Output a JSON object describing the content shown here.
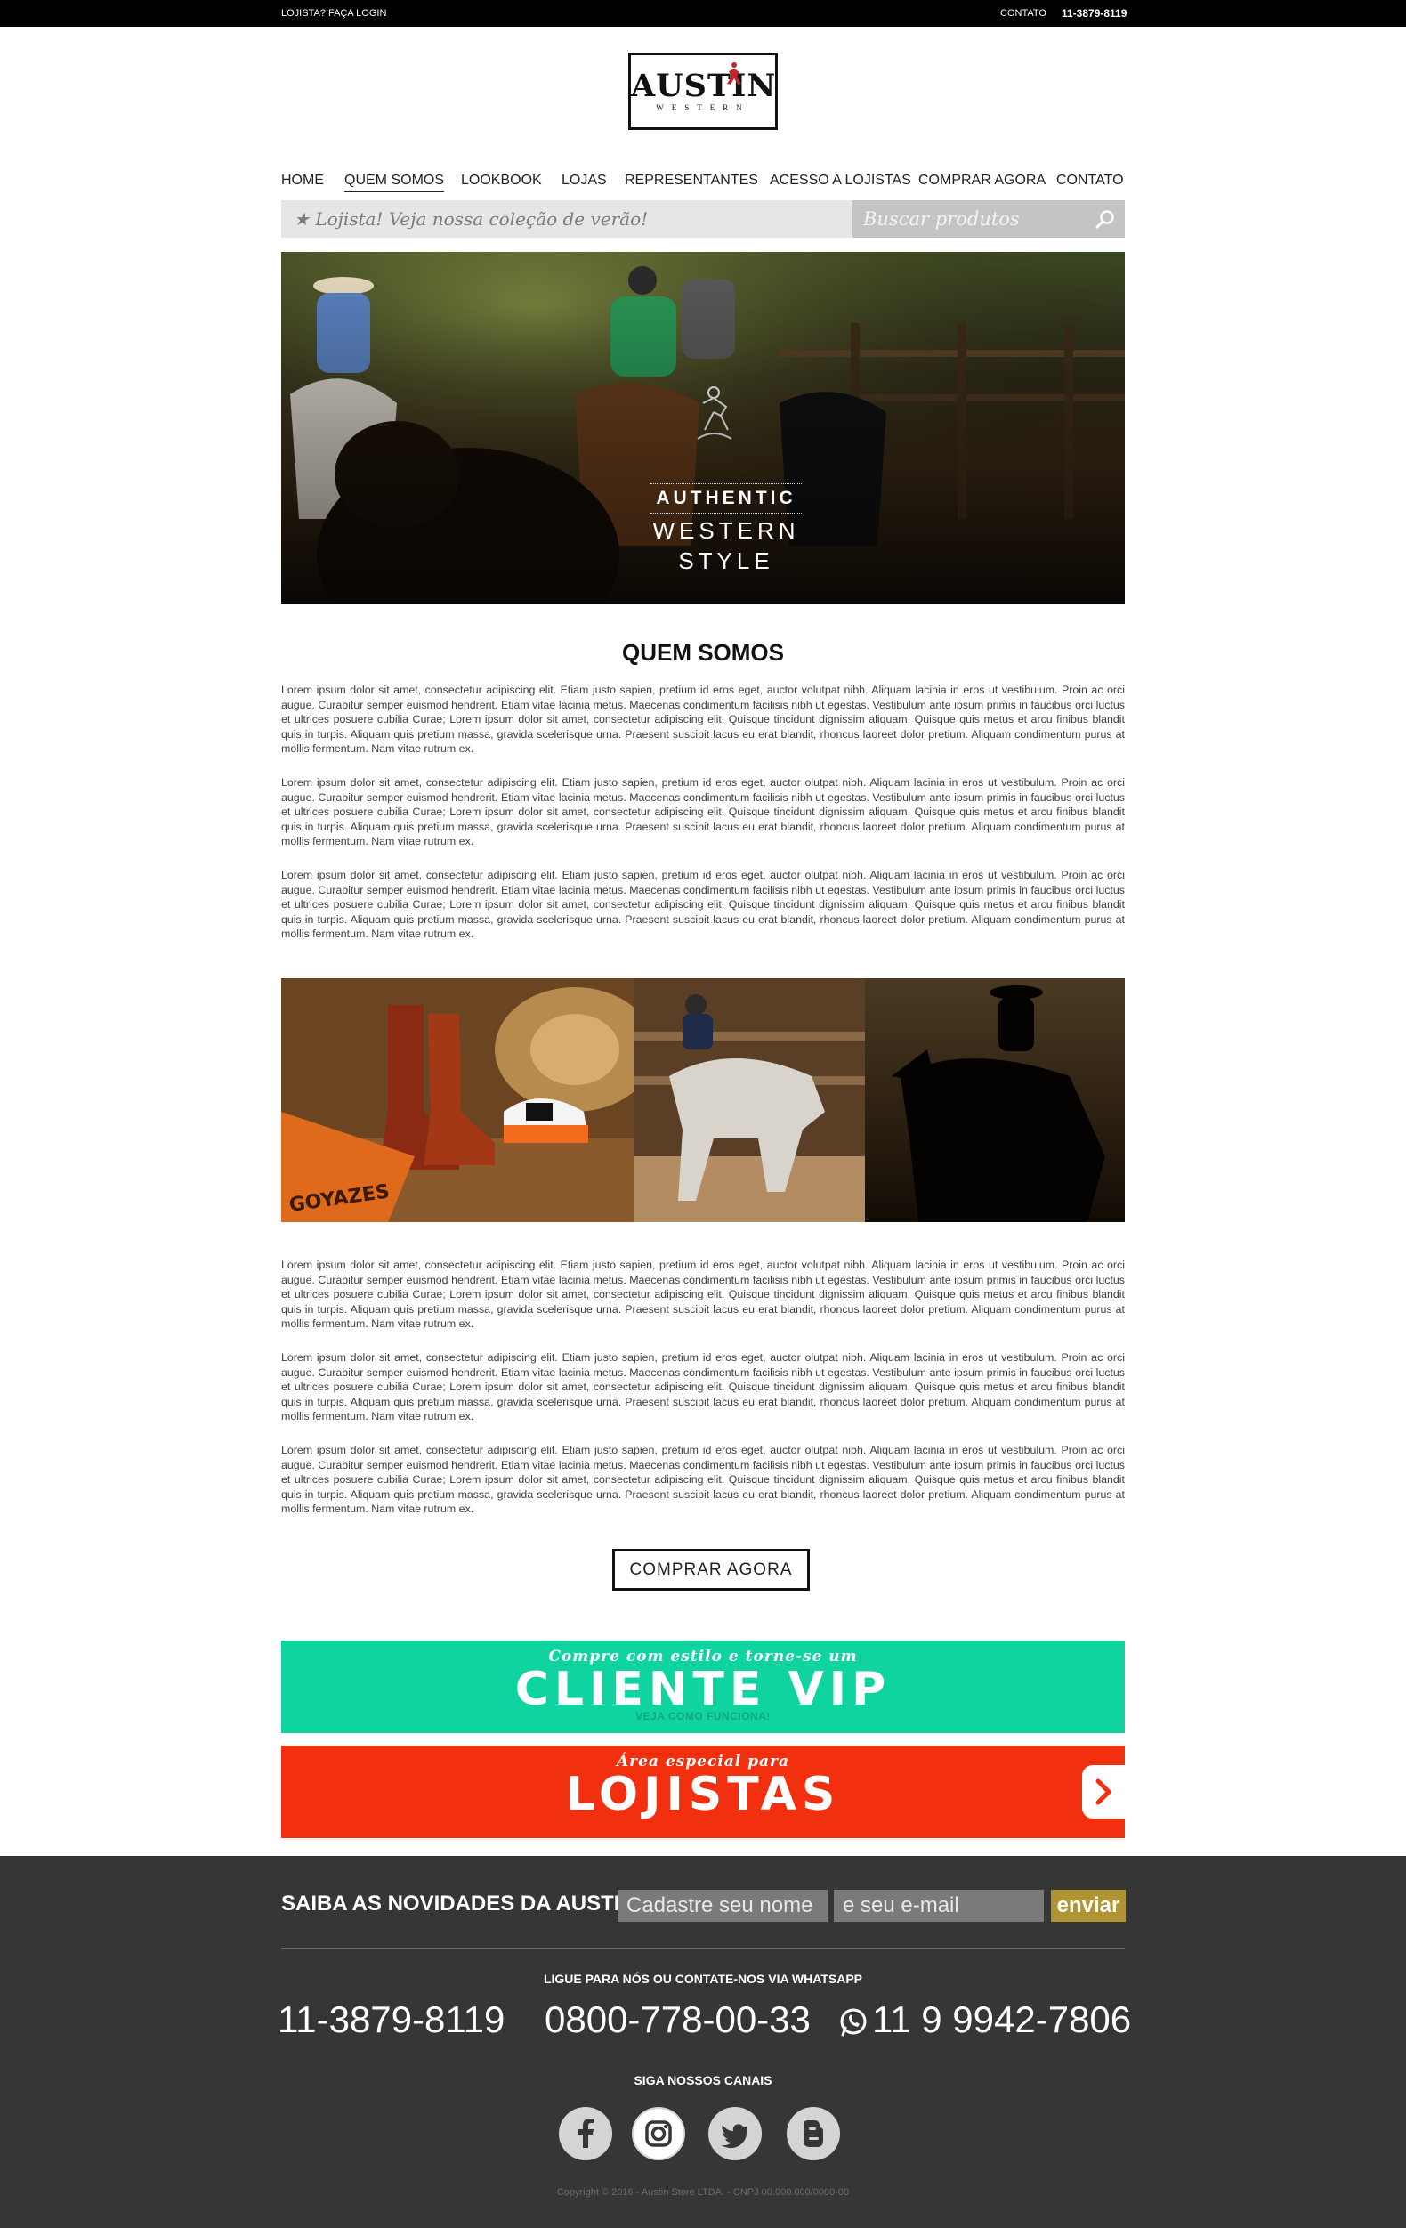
{
  "topbar": {
    "login": "LOJISTA? FAÇA LOGIN",
    "contact_label": "CONTATO",
    "phone": "11-3879-8119"
  },
  "logo": {
    "name": "AUSTIN",
    "tagline": "WESTERN"
  },
  "nav": [
    {
      "label": "HOME"
    },
    {
      "label": "QUEM SOMOS"
    },
    {
      "label": "LOOKBOOK"
    },
    {
      "label": "LOJAS"
    },
    {
      "label": "REPRESENTANTES"
    },
    {
      "label": "ACESSO A LOJISTAS"
    },
    {
      "label": "COMPRAR AGORA"
    },
    {
      "label": "CONTATO"
    }
  ],
  "promo": {
    "text": "★ Lojista! Veja nossa coleção de verão!"
  },
  "search": {
    "placeholder": "Buscar produtos",
    "icon": "search-icon"
  },
  "hero": {
    "line1": "AUTHENTIC",
    "line2": "WESTERN",
    "line3": "STYLE"
  },
  "main": {
    "title": "QUEM SOMOS",
    "paragraphs": [
      "Lorem ipsum dolor sit amet, consectetur adipiscing elit. Etiam justo sapien, pretium id eros eget, auctor volutpat nibh. Aliquam lacinia in eros ut vestibulum. Proin ac orci augue. Curabitur semper euismod hendrerit. Etiam vitae lacinia metus. Maecenas condimentum facilisis nibh ut egestas. Vestibulum ante ipsum primis in faucibus orci luctus et ultrices posuere cubilia Curae; Lorem ipsum dolor sit amet, consectetur adipiscing elit. Quisque tincidunt dignissim aliquam. Quisque quis metus et arcu finibus blandit quis in turpis. Aliquam quis pretium massa, gravida scelerisque urna. Praesent suscipit lacus eu erat blandit, rhoncus laoreet dolor pretium. Aliquam condimentum purus at mollis fermentum. Nam vitae rutrum ex.",
      "Lorem ipsum dolor sit amet, consectetur adipiscing elit. Etiam justo sapien, pretium id eros eget, auctor olutpat nibh. Aliquam lacinia in eros ut vestibulum. Proin ac orci augue. Curabitur semper euismod hendrerit. Etiam vitae lacinia metus. Maecenas condimentum facilisis nibh ut egestas. Vestibulum ante ipsum primis in faucibus orci luctus et ultrices posuere cubilia Curae; Lorem ipsum dolor sit amet, consectetur adipiscing elit. Quisque tincidunt dignissim aliquam. Quisque quis metus et arcu finibus blandit quis in turpis. Aliquam quis pretium massa, gravida scelerisque urna. Praesent suscipit lacus eu erat blandit, rhoncus laoreet dolor pretium. Aliquam condimentum purus at mollis fermentum. Nam vitae rutrum ex.",
      "Lorem ipsum dolor sit amet, consectetur adipiscing elit. Etiam justo sapien, pretium id eros eget, auctor olutpat nibh. Aliquam lacinia in eros ut vestibulum. Proin ac orci augue. Curabitur semper euismod hendrerit. Etiam vitae lacinia metus. Maecenas condimentum facilisis nibh ut egestas. Vestibulum ante ipsum primis in faucibus orci luctus et ultrices posuere cubilia Curae; Lorem ipsum dolor sit amet, consectetur adipiscing elit. Quisque tincidunt dignissim aliquam. Quisque quis metus et arcu finibus blandit quis in turpis. Aliquam quis pretium massa, gravida scelerisque urna. Praesent suscipit lacus eu erat blandit, rhoncus laoreet dolor pretium. Aliquam condimentum purus at mollis fermentum. Nam vitae rutrum ex.",
      "Lorem ipsum dolor sit amet, consectetur adipiscing elit. Etiam justo sapien, pretium id eros eget, auctor volutpat nibh. Aliquam lacinia in eros ut vestibulum. Proin ac orci augue. Curabitur semper euismod hendrerit. Etiam vitae lacinia metus. Maecenas condimentum facilisis nibh ut egestas. Vestibulum ante ipsum primis in faucibus orci luctus et ultrices posuere cubilia Curae; Lorem ipsum dolor sit amet, consectetur adipiscing elit. Quisque tincidunt dignissim aliquam. Quisque quis metus et arcu finibus blandit quis in turpis. Aliquam quis pretium massa, gravida scelerisque urna. Praesent suscipit lacus eu erat blandit, rhoncus laoreet dolor pretium. Aliquam condimentum purus at mollis fermentum. Nam vitae rutrum ex.",
      "Lorem ipsum dolor sit amet, consectetur adipiscing elit. Etiam justo sapien, pretium id eros eget, auctor olutpat nibh. Aliquam lacinia in eros ut vestibulum. Proin ac orci augue. Curabitur semper euismod hendrerit. Etiam vitae lacinia metus. Maecenas condimentum facilisis nibh ut egestas. Vestibulum ante ipsum primis in faucibus orci luctus et ultrices posuere cubilia Curae; Lorem ipsum dolor sit amet, consectetur adipiscing elit. Quisque tincidunt dignissim aliquam. Quisque quis metus et arcu finibus blandit quis in turpis. Aliquam quis pretium massa, gravida scelerisque urna. Praesent suscipit lacus eu erat blandit, rhoncus laoreet dolor pretium. Aliquam condimentum purus at mollis fermentum. Nam vitae rutrum ex.",
      "Lorem ipsum dolor sit amet, consectetur adipiscing elit. Etiam justo sapien, pretium id eros eget, auctor olutpat nibh. Aliquam lacinia in eros ut vestibulum. Proin ac orci augue. Curabitur semper euismod hendrerit. Etiam vitae lacinia metus. Maecenas condimentum facilisis nibh ut egestas. Vestibulum ante ipsum primis in faucibus orci luctus et ultrices posuere cubilia Curae; Lorem ipsum dolor sit amet, consectetur adipiscing elit. Quisque tincidunt dignissim aliquam. Quisque quis metus et arcu finibus blandit quis in turpis. Aliquam quis pretium massa, gravida scelerisque urna. Praesent suscipit lacus eu erat blandit, rhoncus laoreet dolor pretium. Aliquam condimentum purus at mollis fermentum. Nam vitae rutrum ex."
    ],
    "photo_brand": "GOYAZES",
    "buy_button": "COMPRAR AGORA"
  },
  "banners": {
    "vip": {
      "kicker": "Compre com estilo e torne-se um",
      "title": "CLIENTE VIP",
      "subtitle": "VEJA COMO FUNCIONA!",
      "color": "#10d49f"
    },
    "lojistas": {
      "kicker": "Área especial para",
      "title": "LOJISTAS",
      "color": "#f2300f"
    }
  },
  "footer": {
    "newsletter_label": "SAIBA AS NOVIDADES DA AUSTIN:",
    "name_placeholder": "Cadastre seu nome",
    "email_placeholder": "e seu e-mail",
    "send_label": "enviar",
    "call_label": "LIGUE PARA NÓS OU CONTATE-NOS VIA WHATSAPP",
    "phones": [
      "11-3879-8119",
      "0800-778-00-33",
      "11 9 9942-7806"
    ],
    "follow_label": "SIGA NOSSOS CANAIS",
    "social": [
      "facebook-icon",
      "instagram-icon",
      "twitter-icon",
      "blogger-icon"
    ],
    "copyright": "Copyright © 2016 - Austin Store LTDA. - CNPJ 00.000.000/0000-00",
    "accent": "#b09432"
  }
}
